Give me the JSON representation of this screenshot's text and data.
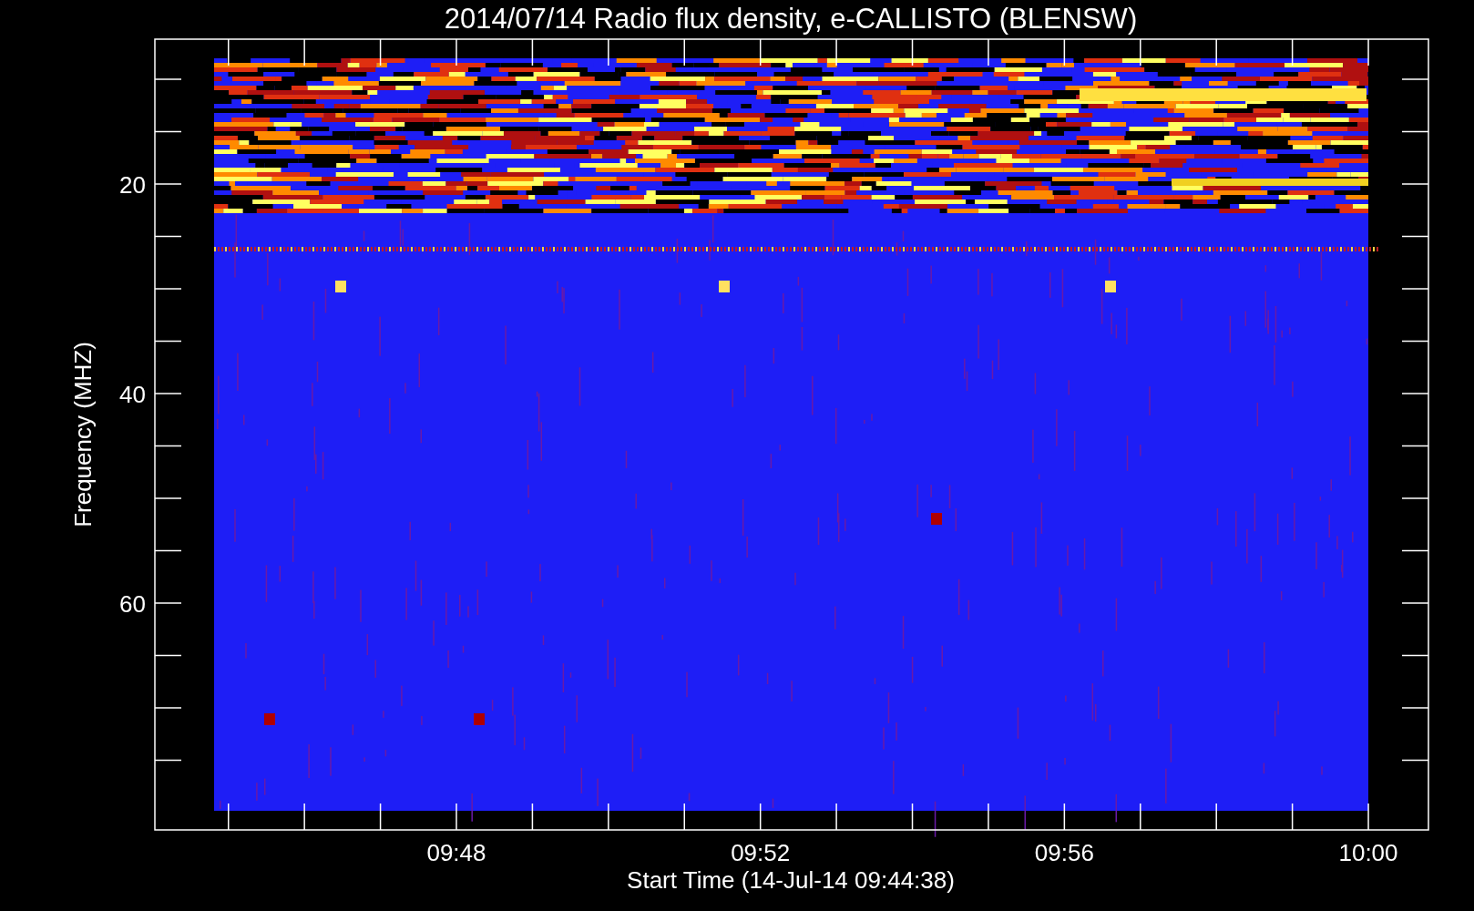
{
  "plot": {
    "title": "2014/07/14  Radio flux density, e-CALLISTO (BLENSW)",
    "y_axis": {
      "label": "Frequency (MHZ)",
      "ticks": [
        "20",
        "40",
        "60"
      ]
    },
    "x_axis": {
      "label": "Start Time (14-Jul-14 09:44:38)",
      "ticks": [
        "09:48",
        "09:52",
        "09:56",
        "10:00"
      ]
    }
  }
}
